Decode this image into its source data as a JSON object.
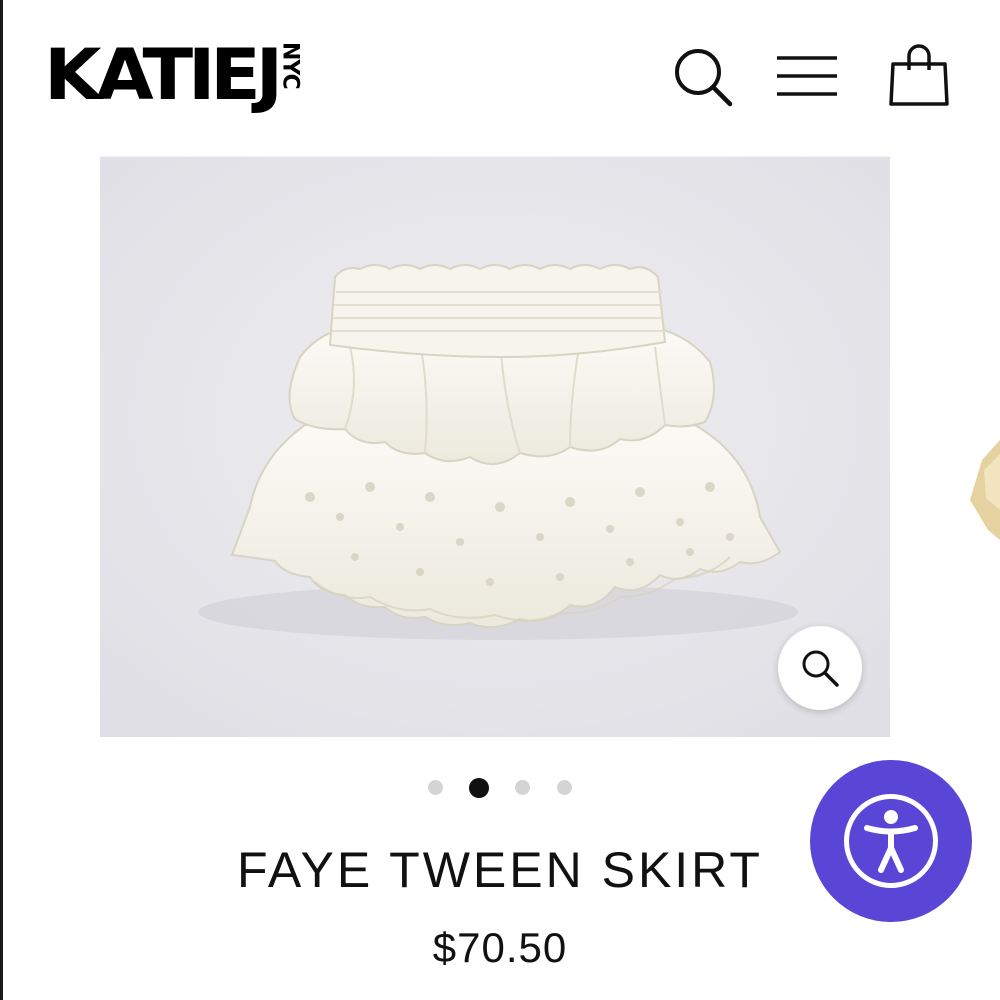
{
  "brand": {
    "logo_main": "KATIEJ",
    "logo_sub": "NYC"
  },
  "header": {
    "icons": [
      "search-icon",
      "menu-icon",
      "shopping-bag-icon"
    ]
  },
  "product": {
    "title": "FAYE TWEEN SKIRT",
    "price": "$70.50"
  },
  "gallery": {
    "image_count": 4,
    "active_index": 1,
    "zoom_icon": "zoom-icon"
  },
  "accessibility_widget": {
    "icon": "accessibility-icon",
    "color": "#5a46d6"
  },
  "colors": {
    "text": "#111111",
    "image_bg": "#e8e8ec",
    "dot_inactive": "#d4d4d4"
  }
}
